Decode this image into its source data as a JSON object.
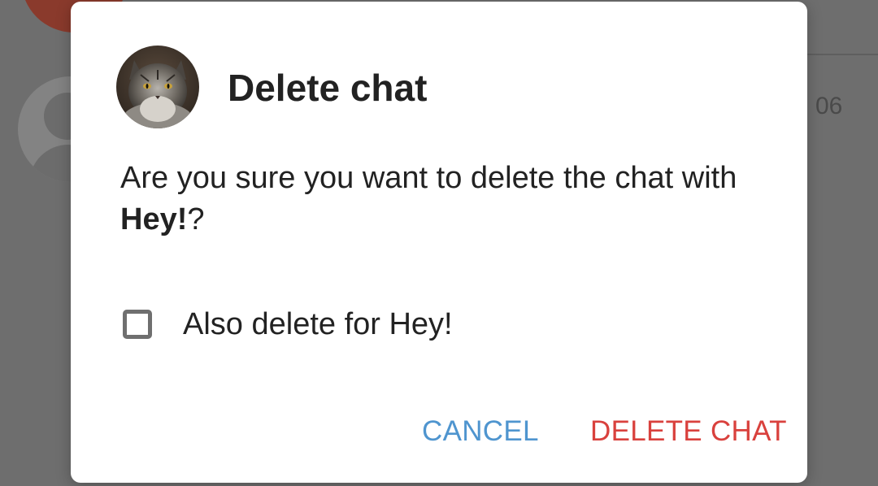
{
  "background": {
    "chat_time": "06"
  },
  "dialog": {
    "title": "Delete chat",
    "avatar": "cat-avatar",
    "message_prefix": "Are you sure you want to delete the chat with ",
    "message_name": "Hey!",
    "message_suffix": "?",
    "checkbox": {
      "label": "Also delete for Hey!",
      "checked": false
    },
    "buttons": {
      "cancel_label": "CANCEL",
      "delete_label": "DELETE CHAT"
    }
  },
  "colors": {
    "cancel": "#4f95cf",
    "delete": "#d9413d",
    "overlay": "#6e6e6e"
  }
}
